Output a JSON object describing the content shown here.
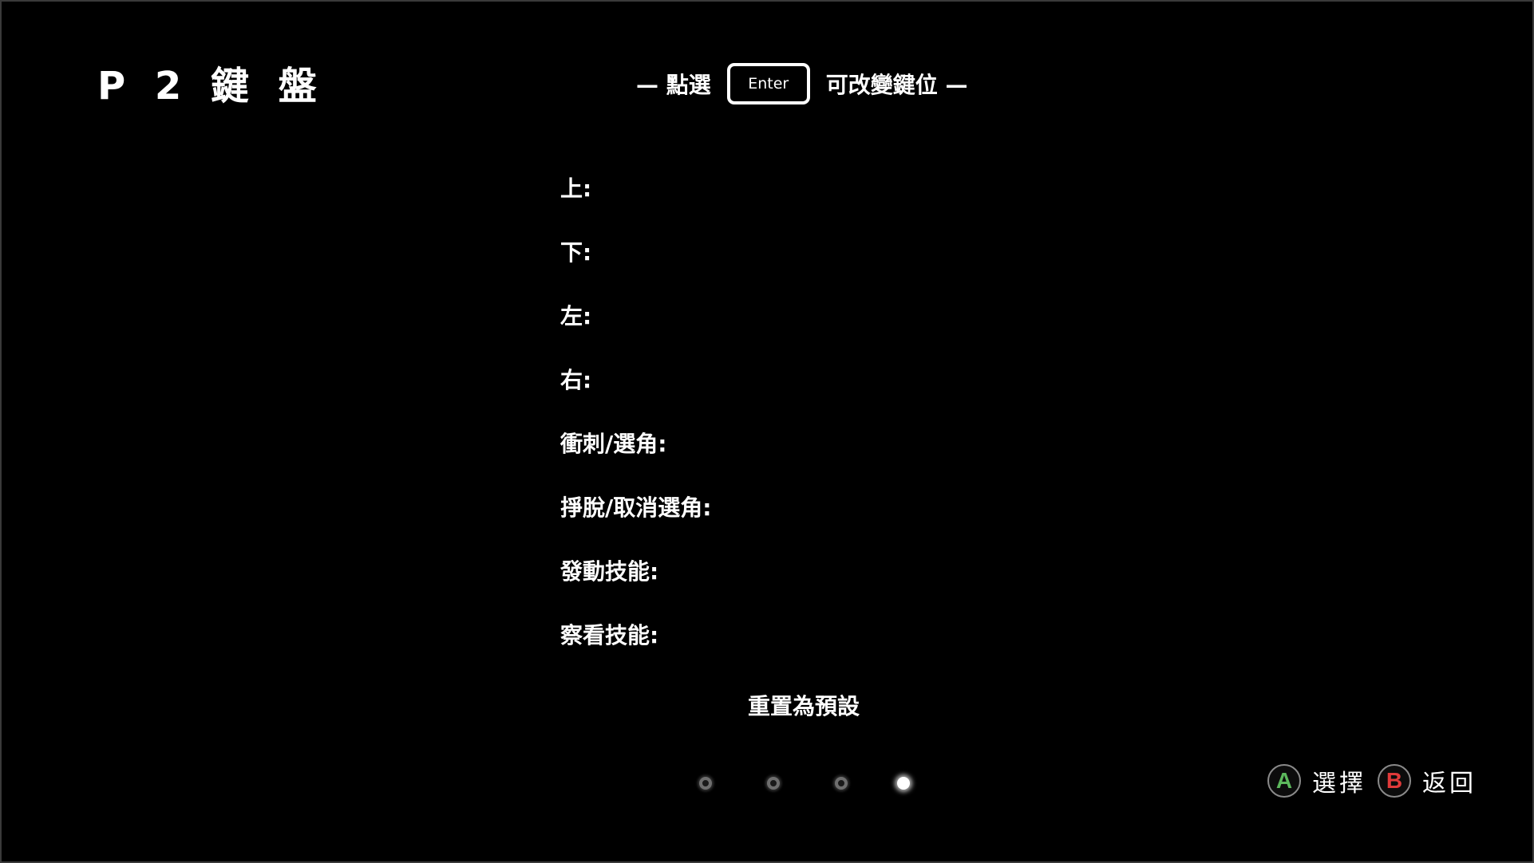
{
  "title": "P 2 鍵 盤",
  "hint": {
    "prefix": "— 點選",
    "key": "Enter",
    "suffix": "可改變鍵位 —"
  },
  "bindings": [
    {
      "label": "上:",
      "key": ""
    },
    {
      "label": "下:",
      "key": ""
    },
    {
      "label": "左:",
      "key": ""
    },
    {
      "label": "右:",
      "key": ""
    },
    {
      "label": "衝刺/選角:",
      "key": ""
    },
    {
      "label": "掙脫/取消選角:",
      "key": ""
    },
    {
      "label": "發動技能:",
      "key": ""
    },
    {
      "label": "察看技能:",
      "key": ""
    }
  ],
  "reset_label": "重置為預設",
  "pager": {
    "total": 4,
    "active": 4
  },
  "controls": {
    "a_button": "A",
    "a_color": "#5cb85c",
    "a_label": "選擇",
    "b_button": "B",
    "b_color": "#e03a3a",
    "b_label": "返回"
  }
}
